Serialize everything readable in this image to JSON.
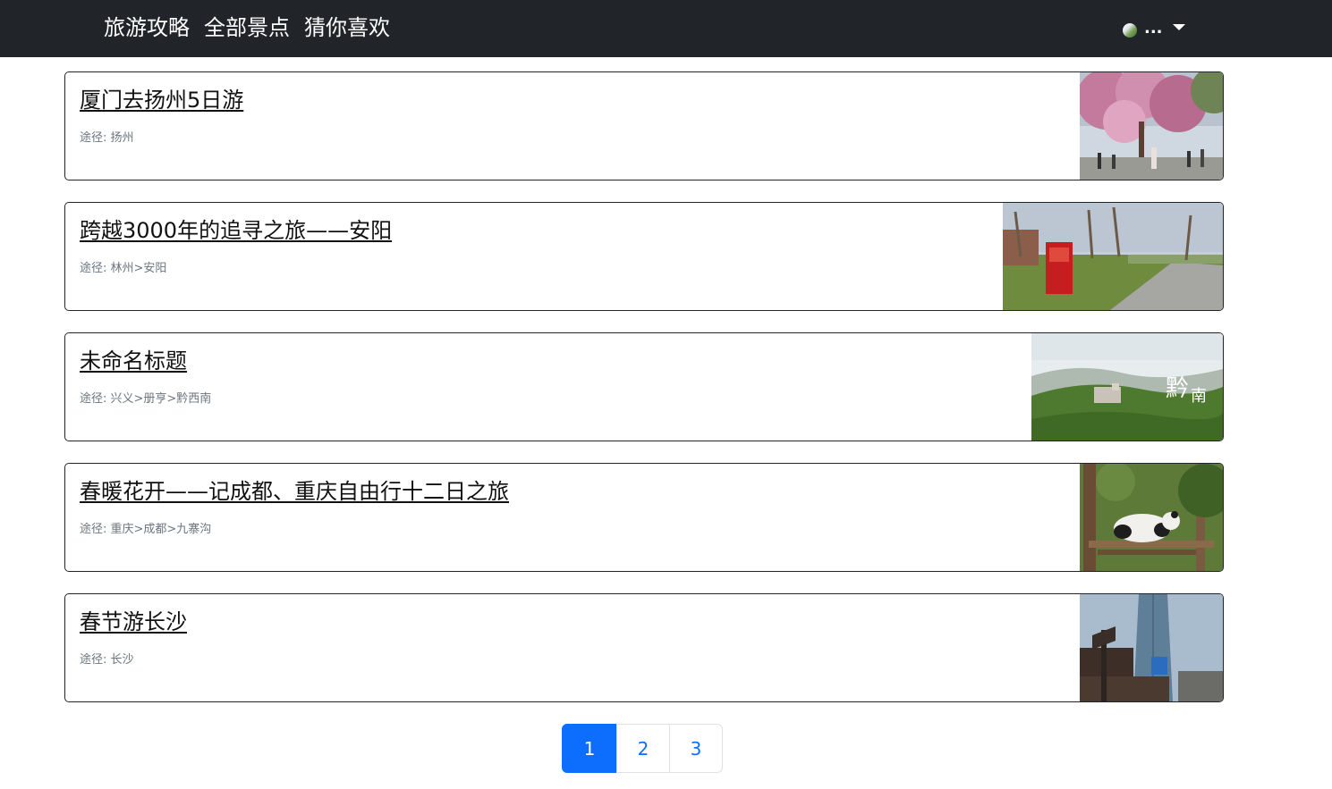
{
  "navbar": {
    "links": [
      "旅游攻略",
      "全部景点",
      "猜你喜欢"
    ],
    "user": {
      "name": "...",
      "avatar_icon": "avatar-image",
      "menu_icon": "caret-down-icon"
    }
  },
  "cards": [
    {
      "title": "厦门去扬州5日游",
      "route": "途径: 扬州",
      "thumb": "cherry-blossom-park-photo"
    },
    {
      "title": "跨越3000年的追寻之旅——安阳",
      "route": "途径: 林州>安阳",
      "thumb": "park-with-red-sign-photo"
    },
    {
      "title": "未命名标题",
      "route": "途径: 兴义>册亨>黔西南",
      "thumb": "qianxinan-aerial-photo"
    },
    {
      "title": "春暖花开——记成都、重庆自由行十二日之旅",
      "route": "途径: 重庆>成都>九寨沟",
      "thumb": "panda-sleeping-photo"
    },
    {
      "title": "春节游长沙",
      "route": "途径: 长沙",
      "thumb": "changsha-tower-photo"
    }
  ],
  "pagination": {
    "pages": [
      "1",
      "2",
      "3"
    ],
    "active": "1"
  },
  "colors": {
    "navbar": "#212529",
    "accent": "#0d6efd",
    "muted": "#6c757d"
  }
}
